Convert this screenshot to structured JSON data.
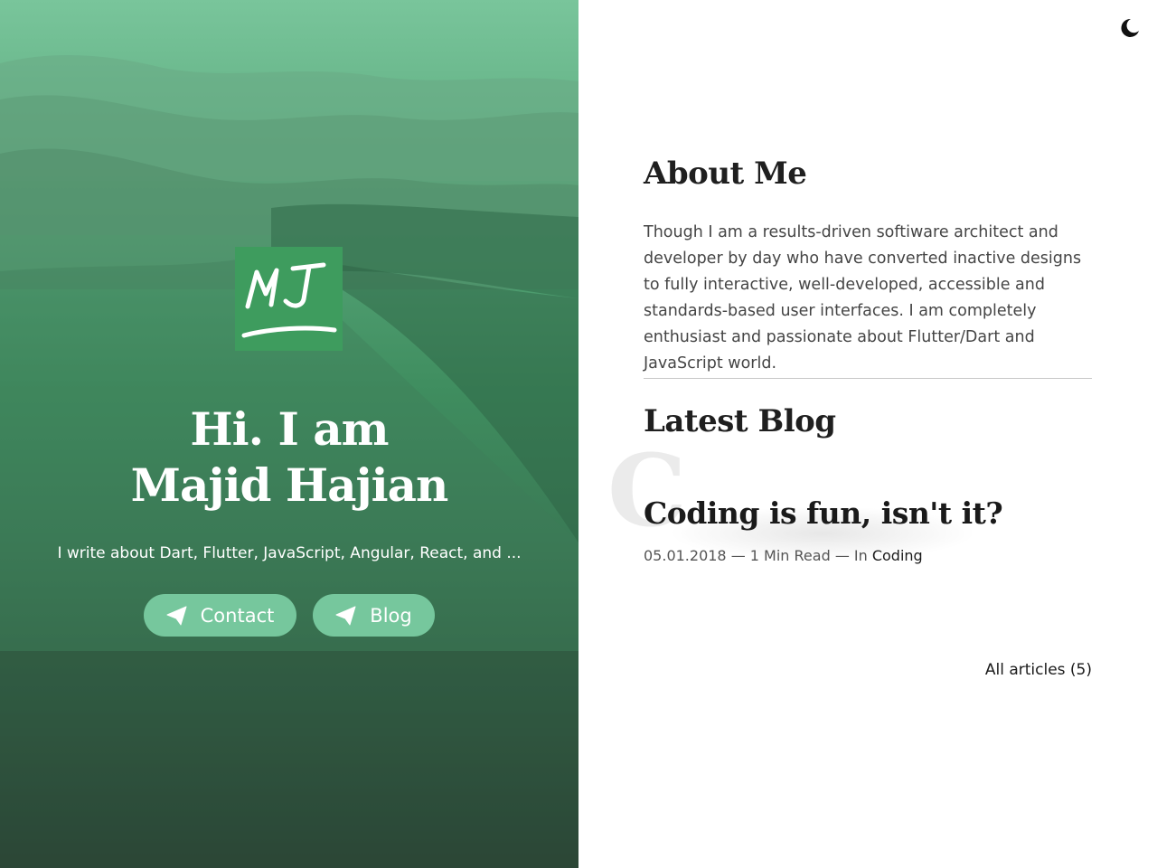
{
  "hero": {
    "logo_text": "MJ",
    "title_line1": "Hi. I am",
    "title_line2": "Majid Hajian",
    "subtitle": "I write about Dart, Flutter, JavaScript, Angular, React, and ...",
    "buttons": [
      {
        "label": "Contact",
        "icon": "paper-plane-icon"
      },
      {
        "label": "Blog",
        "icon": "paper-plane-icon"
      }
    ]
  },
  "header": {
    "theme_toggle_icon": "moon-icon"
  },
  "about": {
    "heading": "About Me",
    "text": "Though I am a results-driven softiware architect and developer by day who have converted inactive designs to fully interactive, well-developed, accessible and standards-based user interfaces. I am completely enthusiast and passionate about Flutter/Dart and JavaScript world."
  },
  "blog": {
    "heading": "Latest Blog",
    "ghost_letter": "C",
    "post": {
      "title": "Coding is fun, isn't it?",
      "meta_prefix": "05.01.2018 — 1 Min Read — In ",
      "category": "Coding"
    },
    "all_articles": "All articles (5)"
  },
  "colors": {
    "accent": "#76c79d",
    "logo_bg": "#3e9c5e",
    "heading": "#1f1f1f",
    "body_text": "#454545"
  }
}
